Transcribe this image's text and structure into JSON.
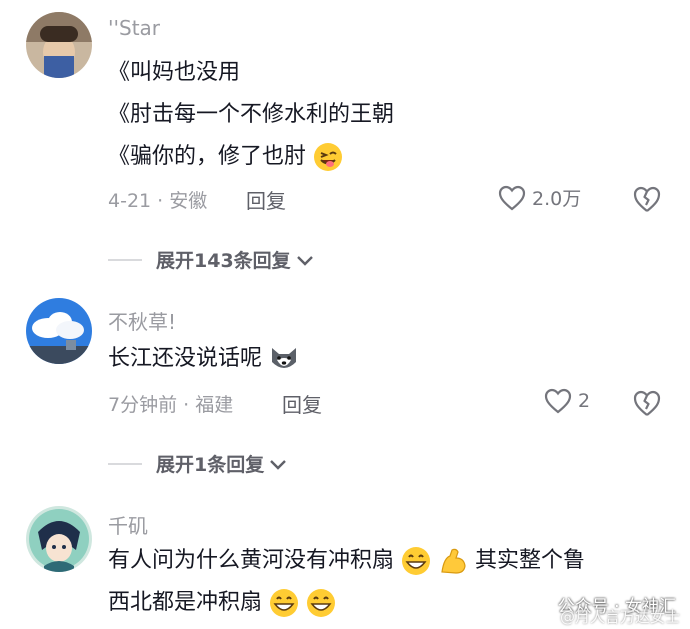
{
  "comments": [
    {
      "username": "''Star",
      "lines": [
        "《叫妈也没用",
        "《肘击每一个不修水利的王朝",
        "《骗你的，修了也肘"
      ],
      "meta": "4-21 · 安徽",
      "reply_label": "回复",
      "likes": "2.0万",
      "expand_label": "展开143条回复"
    },
    {
      "username": "不秋草!",
      "lines": [
        "长江还没说话呢"
      ],
      "meta": "7分钟前 · 福建",
      "reply_label": "回复",
      "likes": "2",
      "expand_label": "展开1条回复"
    },
    {
      "username": "千矶",
      "lines": [
        "有人问为什么黄河没有冲积扇",
        "其实整个鲁",
        "西北都是冲积扇"
      ]
    }
  ],
  "icons": {
    "like": "heart-outline-icon",
    "dislike": "broken-heart-icon",
    "expand": "chevron-down-icon",
    "emoji_wink": "winking-tongue-emoji",
    "emoji_husky": "husky-emoji",
    "emoji_grin": "grinning-emoji",
    "emoji_muscle": "flexed-biceps-emoji"
  },
  "watermark": {
    "text": "公众号 · 女神汇",
    "overlay": "@月人言万达女士"
  },
  "colors": {
    "text": "#161823",
    "secondary": "#9a9ba1",
    "accent_gray": "#5f6068"
  }
}
